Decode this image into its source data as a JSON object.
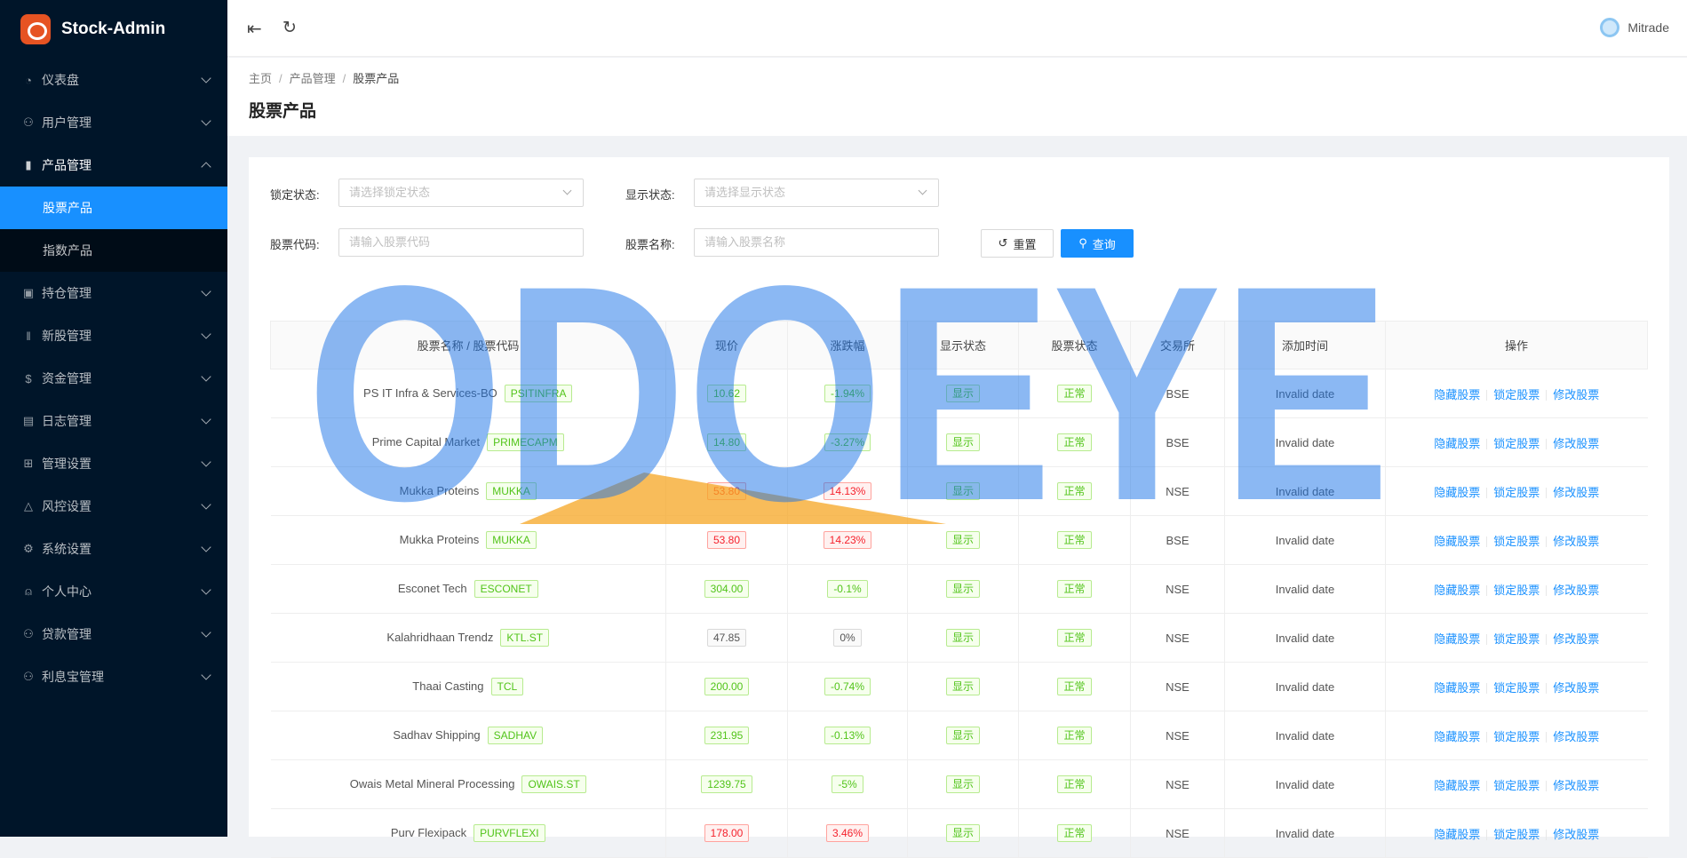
{
  "app": {
    "title": "Stock-Admin"
  },
  "sidebar": {
    "items": [
      {
        "label": "仪表盘",
        "icon": "dashboard-icon"
      },
      {
        "label": "用户管理",
        "icon": "user-manage-icon"
      },
      {
        "label": "产品管理",
        "icon": "chart-icon",
        "open": true,
        "children": [
          {
            "label": "股票产品",
            "active": true
          },
          {
            "label": "指数产品"
          }
        ]
      },
      {
        "label": "持仓管理",
        "icon": "position-icon"
      },
      {
        "label": "新股管理",
        "icon": "ipo-icon"
      },
      {
        "label": "资金管理",
        "icon": "money-icon"
      },
      {
        "label": "日志管理",
        "icon": "log-icon"
      },
      {
        "label": "管理设置",
        "icon": "admin-settings-icon"
      },
      {
        "label": "风控设置",
        "icon": "warning-icon"
      },
      {
        "label": "系统设置",
        "icon": "gear-icon"
      },
      {
        "label": "个人中心",
        "icon": "person-icon"
      },
      {
        "label": "贷款管理",
        "icon": "loan-icon"
      },
      {
        "label": "利息宝管理",
        "icon": "interest-icon"
      }
    ]
  },
  "header": {
    "user": "Mitrade"
  },
  "breadcrumb": [
    "主页",
    "产品管理",
    "股票产品"
  ],
  "page_title": "股票产品",
  "filters": {
    "lock_label": "锁定状态:",
    "lock_placeholder": "请选择锁定状态",
    "show_label": "显示状态:",
    "show_placeholder": "请选择显示状态",
    "code_label": "股票代码:",
    "code_placeholder": "请输入股票代码",
    "name_label": "股票名称:",
    "name_placeholder": "请输入股票名称",
    "reset": "重置",
    "query": "查询"
  },
  "table": {
    "headers": [
      "股票名称 / 股票代码",
      "现价",
      "涨跌幅",
      "显示状态",
      "股票状态",
      "交易所",
      "添加时间",
      "操作"
    ],
    "actions": [
      "隐藏股票",
      "锁定股票",
      "修改股票"
    ],
    "rows": [
      {
        "name": "PS IT Infra & Services-BO",
        "code": "PSITINFRA",
        "price": "10.62",
        "price_color": "green",
        "change": "-1.94%",
        "change_color": "green",
        "show": "显示",
        "status": "正常",
        "exchange": "BSE",
        "added": "Invalid date"
      },
      {
        "name": "Prime Capital Market",
        "code": "PRIMECAPM",
        "price": "14.80",
        "price_color": "green",
        "change": "-3.27%",
        "change_color": "green",
        "show": "显示",
        "status": "正常",
        "exchange": "BSE",
        "added": "Invalid date"
      },
      {
        "name": "Mukka Proteins",
        "code": "MUKKA",
        "price": "53.80",
        "price_color": "red",
        "change": "14.13%",
        "change_color": "red",
        "show": "显示",
        "status": "正常",
        "exchange": "NSE",
        "added": "Invalid date"
      },
      {
        "name": "Mukka Proteins",
        "code": "MUKKA",
        "price": "53.80",
        "price_color": "red",
        "change": "14.23%",
        "change_color": "red",
        "show": "显示",
        "status": "正常",
        "exchange": "BSE",
        "added": "Invalid date"
      },
      {
        "name": "Esconet Tech",
        "code": "ESCONET",
        "price": "304.00",
        "price_color": "green",
        "change": "-0.1%",
        "change_color": "green",
        "show": "显示",
        "status": "正常",
        "exchange": "NSE",
        "added": "Invalid date"
      },
      {
        "name": "Kalahridhaan Trendz",
        "code": "KTL.ST",
        "price": "47.85",
        "price_color": "default",
        "change": "0%",
        "change_color": "default",
        "show": "显示",
        "status": "正常",
        "exchange": "NSE",
        "added": "Invalid date"
      },
      {
        "name": "Thaai Casting",
        "code": "TCL",
        "price": "200.00",
        "price_color": "green",
        "change": "-0.74%",
        "change_color": "green",
        "show": "显示",
        "status": "正常",
        "exchange": "NSE",
        "added": "Invalid date"
      },
      {
        "name": "Sadhav Shipping",
        "code": "SADHAV",
        "price": "231.95",
        "price_color": "green",
        "change": "-0.13%",
        "change_color": "green",
        "show": "显示",
        "status": "正常",
        "exchange": "NSE",
        "added": "Invalid date"
      },
      {
        "name": "Owais Metal Mineral Processing",
        "code": "OWAIS.ST",
        "price": "1239.75",
        "price_color": "green",
        "change": "-5%",
        "change_color": "green",
        "show": "显示",
        "status": "正常",
        "exchange": "NSE",
        "added": "Invalid date"
      },
      {
        "name": "Purv Flexipack",
        "code": "PURVFLEXI",
        "price": "178.00",
        "price_color": "red",
        "change": "3.46%",
        "change_color": "red",
        "show": "显示",
        "status": "正常",
        "exchange": "NSE",
        "added": "Invalid date"
      }
    ]
  },
  "watermark": {
    "text": "ODOEYE",
    "color": "#1a73e8",
    "accent": "#f5a623"
  }
}
